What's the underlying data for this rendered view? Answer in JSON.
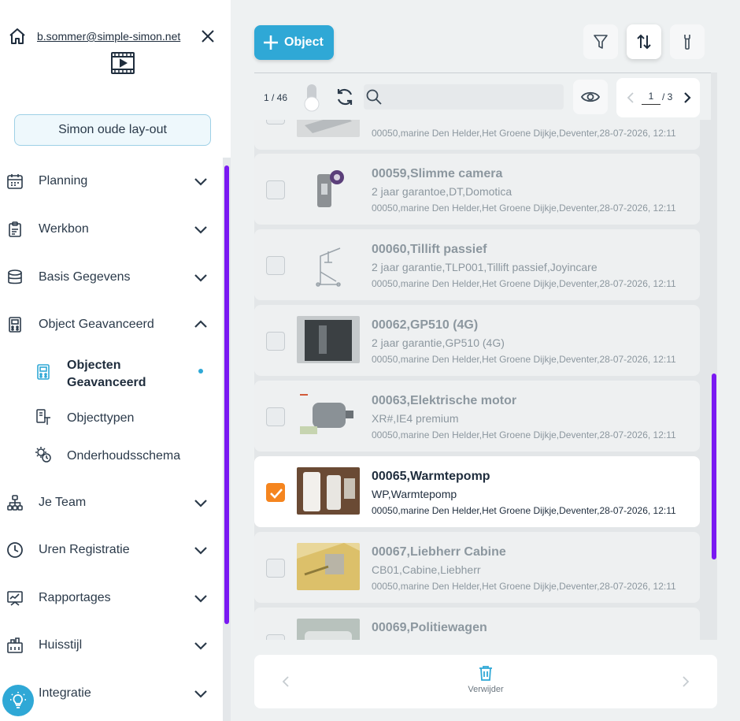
{
  "user": {
    "email": "b.sommer@simple-simon.net"
  },
  "sidebar": {
    "layout_button": "Simon oude lay-out",
    "items": [
      {
        "label": "Planning",
        "icon": "calendar-icon"
      },
      {
        "label": "Werkbon",
        "icon": "clipboard-icon"
      },
      {
        "label": "Basis Gegevens",
        "icon": "database-icon"
      },
      {
        "label": "Object Geavanceerd",
        "icon": "object-icon"
      },
      {
        "label": "Je Team",
        "icon": "team-icon"
      },
      {
        "label": "Uren Registratie",
        "icon": "clock-icon"
      },
      {
        "label": "Rapportages",
        "icon": "report-icon"
      },
      {
        "label": "Huisstijl",
        "icon": "style-icon"
      },
      {
        "label": "Integratie",
        "icon": "integration-icon"
      }
    ],
    "subitems": [
      {
        "label": "Objecten Geavanceerd",
        "active": true
      },
      {
        "label": "Objecttypen"
      },
      {
        "label": "Onderhoudsschema"
      }
    ]
  },
  "toolbar": {
    "add_label": "Object"
  },
  "list": {
    "count": "1 / 46",
    "page_current": "1",
    "page_total": "/ 3",
    "rows": [
      {
        "title": "",
        "sub": "",
        "meta": "00050,marine Den Helder,Het Groene Dijkje,Deventer,28-07-2026, 12:11",
        "selected": false
      },
      {
        "title": "00059,Slimme camera",
        "sub": "2 jaar garantoe,DT,Domotica",
        "meta": "00050,marine Den Helder,Het Groene Dijkje,Deventer,28-07-2026, 12:11",
        "selected": false
      },
      {
        "title": "00060,Tillift passief",
        "sub": "2 jaar garantie,TLP001,Tillift passief,Joyincare",
        "meta": "00050,marine Den Helder,Het Groene Dijkje,Deventer,28-07-2026, 12:11",
        "selected": false
      },
      {
        "title": "00062,GP510 (4G)",
        "sub": "2 jaar garantie,GP510 (4G)",
        "meta": "00050,marine Den Helder,Het Groene Dijkje,Deventer,28-07-2026, 12:11",
        "selected": false
      },
      {
        "title": "00063,Elektrische motor",
        "sub": "XR#,IE4 premium",
        "meta": "00050,marine Den Helder,Het Groene Dijkje,Deventer,28-07-2026, 12:11",
        "selected": false
      },
      {
        "title": "00065,Warmtepomp",
        "sub": "WP,Warmtepomp",
        "meta": "00050,marine Den Helder,Het Groene Dijkje,Deventer,28-07-2026, 12:11",
        "selected": true
      },
      {
        "title": "00067,Liebherr Cabine",
        "sub": "CB01,Cabine,Liebherr",
        "meta": "00050,marine Den Helder,Het Groene Dijkje,Deventer,28-07-2026, 12:11",
        "selected": false
      },
      {
        "title": "00069,Politiewagen",
        "sub": "",
        "meta": "",
        "selected": false
      }
    ]
  },
  "footer": {
    "delete_label": "Verwijder"
  },
  "colors": {
    "accent": "#2fa8d6",
    "scrollbar": "#7a19f2",
    "checked": "#f5851f"
  }
}
